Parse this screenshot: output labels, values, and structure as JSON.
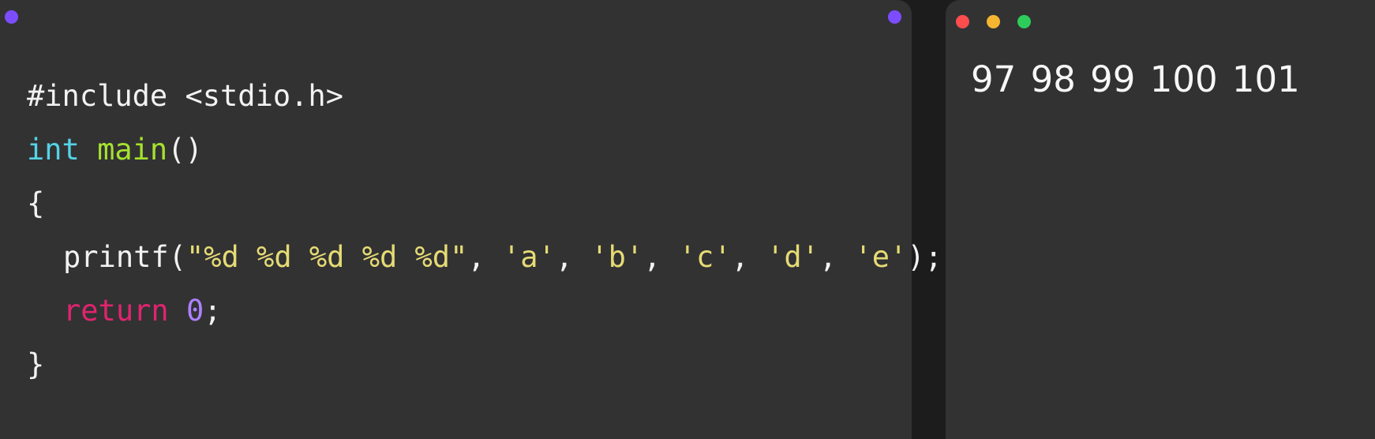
{
  "colors": {
    "background": "#1c1c1c",
    "panel": "#323233",
    "text": "#f2f2f2",
    "type_keyword": "#55d3e6",
    "function_name": "#a6e22e",
    "control_keyword": "#e0246e",
    "number": "#ae81ff",
    "string": "#e6db74",
    "editor_dot": "#7c4dff",
    "close_dot": "#ff4d4f",
    "minimize_dot": "#f5b531",
    "maximize_dot": "#2ecc5b"
  },
  "editor": {
    "corner_dots": [
      {
        "name": "editor-dot-left-icon",
        "color": "#7c4dff"
      },
      {
        "name": "editor-dot-right-icon",
        "color": "#7c4dff"
      }
    ],
    "lines": [
      {
        "tokens": [
          {
            "text": "#include <stdio.h>",
            "color": "#f2f2f2"
          }
        ]
      },
      {
        "tokens": [
          {
            "text": "int",
            "color": "#55d3e6"
          },
          {
            "text": " ",
            "color": "#f2f2f2"
          },
          {
            "text": "main",
            "color": "#a6e22e"
          },
          {
            "text": "()",
            "color": "#f2f2f2"
          }
        ]
      },
      {
        "tokens": [
          {
            "text": "{",
            "color": "#f2f2f2"
          }
        ]
      },
      {
        "tokens": [
          {
            "text": "printf(",
            "color": "#f2f2f2"
          },
          {
            "text": "\"%d %d %d %d %d\"",
            "color": "#e6db74"
          },
          {
            "text": ", ",
            "color": "#f2f2f2"
          },
          {
            "text": "'a'",
            "color": "#e6db74"
          },
          {
            "text": ", ",
            "color": "#f2f2f2"
          },
          {
            "text": "'b'",
            "color": "#e6db74"
          },
          {
            "text": ", ",
            "color": "#f2f2f2"
          },
          {
            "text": "'c'",
            "color": "#e6db74"
          },
          {
            "text": ", ",
            "color": "#f2f2f2"
          },
          {
            "text": "'d'",
            "color": "#e6db74"
          },
          {
            "text": ", ",
            "color": "#f2f2f2"
          },
          {
            "text": "'e'",
            "color": "#e6db74"
          },
          {
            "text": ");",
            "color": "#f2f2f2"
          }
        ]
      },
      {
        "tokens": [
          {
            "text": "return",
            "color": "#e0246e"
          },
          {
            "text": " ",
            "color": "#f2f2f2"
          },
          {
            "text": "0",
            "color": "#ae81ff"
          },
          {
            "text": ";",
            "color": "#f2f2f2"
          }
        ]
      },
      {
        "tokens": [
          {
            "text": "}",
            "color": "#f2f2f2"
          }
        ]
      }
    ]
  },
  "output": {
    "window_buttons": [
      {
        "name": "close-dot-icon",
        "color": "#ff4d4f"
      },
      {
        "name": "minimize-dot-icon",
        "color": "#f5b531"
      },
      {
        "name": "maximize-dot-icon",
        "color": "#2ecc5b"
      }
    ],
    "text": "97 98 99 100 101"
  }
}
